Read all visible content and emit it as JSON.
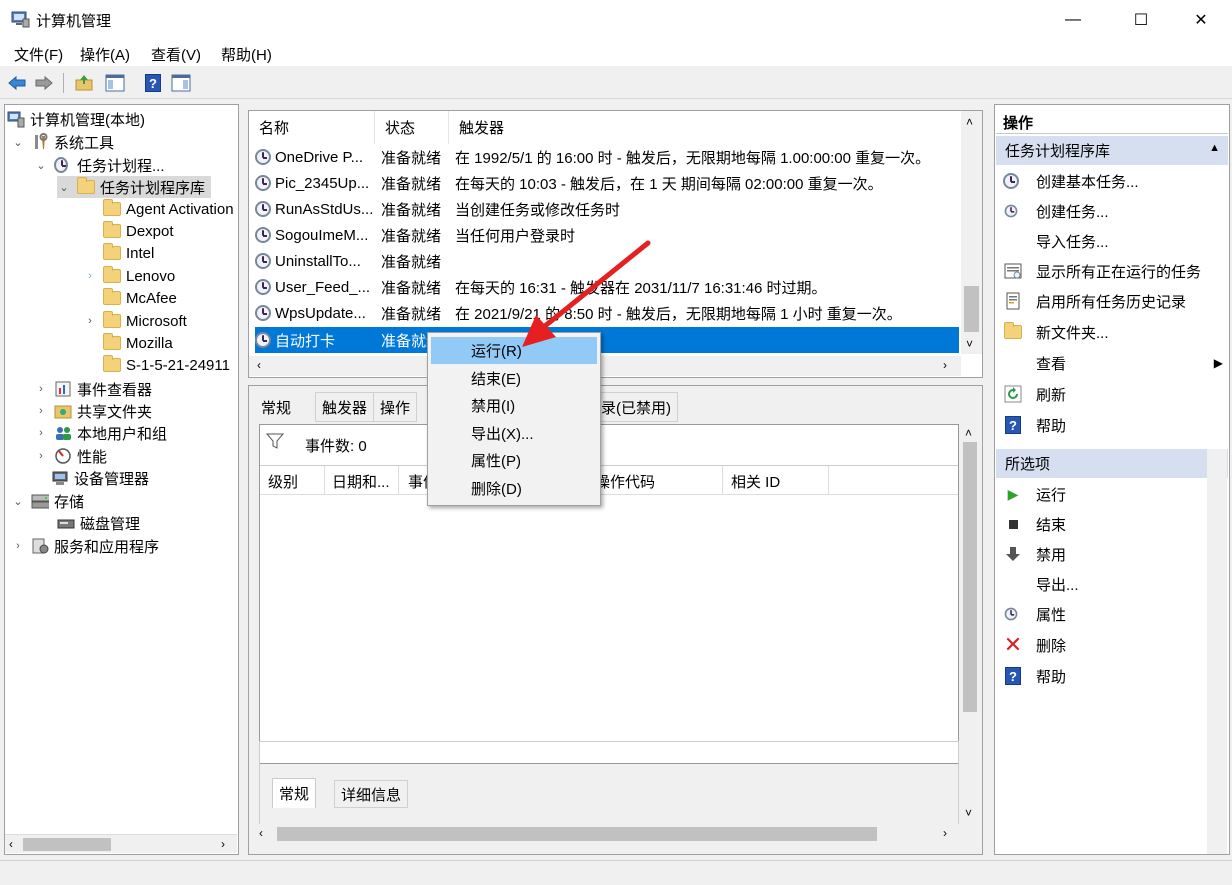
{
  "window": {
    "title": "计算机管理",
    "minimize": "—",
    "maximize": "☐",
    "close": "✕"
  },
  "menu": [
    "文件(F)",
    "操作(A)",
    "查看(V)",
    "帮助(H)"
  ],
  "toolbar": {
    "icons": [
      "back-arrow-icon",
      "forward-arrow-icon",
      "up-folder-icon",
      "show-hide-tree-icon",
      "help-icon",
      "action-pane-icon"
    ]
  },
  "tree": {
    "root": "计算机管理(本地)",
    "system_tools": "系统工具",
    "task_scheduler": "任务计划程...",
    "task_library": "任务计划程序库",
    "folders": [
      "Agent Activation",
      "Dexpot",
      "Intel",
      "Lenovo",
      "McAfee",
      "Microsoft",
      "Mozilla",
      "S-1-5-21-24911"
    ],
    "event_viewer": "事件查看器",
    "shared_folders": "共享文件夹",
    "local_users": "本地用户和组",
    "performance": "性能",
    "device_manager": "设备管理器",
    "storage": "存储",
    "disk_management": "磁盘管理",
    "services_apps": "服务和应用程序"
  },
  "task_list": {
    "columns": [
      "名称",
      "状态",
      "触发器"
    ],
    "rows": [
      {
        "name": "OneDrive P...",
        "status": "准备就绪",
        "trigger": "在 1992/5/1 的 16:00 时 - 触发后，无限期地每隔 1.00:00:00 重复一次。"
      },
      {
        "name": "Pic_2345Up...",
        "status": "准备就绪",
        "trigger": "在每天的 10:03 - 触发后，在 1 天 期间每隔 02:00:00 重复一次。"
      },
      {
        "name": "RunAsStdUs...",
        "status": "准备就绪",
        "trigger": "当创建任务或修改任务时"
      },
      {
        "name": "SogouImeM...",
        "status": "准备就绪",
        "trigger": "当任何用户登录时"
      },
      {
        "name": "UninstallTo...",
        "status": "准备就绪",
        "trigger": ""
      },
      {
        "name": "User_Feed_...",
        "status": "准备就绪",
        "trigger": "在每天的 16:31 - 触发器在 2031/11/7 16:31:46 时过期。"
      },
      {
        "name": "WpsUpdate...",
        "status": "准备就绪",
        "trigger": "在 2021/9/21 的 8:50 时 - 触发后，无限期地每隔 1 小时 重复一次。"
      },
      {
        "name": "自动打卡",
        "status": "准备就绪",
        "trigger": ""
      }
    ]
  },
  "context_menu": [
    "运行(R)",
    "结束(E)",
    "禁用(I)",
    "导出(X)...",
    "属性(P)",
    "删除(D)"
  ],
  "detail": {
    "tabs": [
      "常规",
      "触发器",
      "操作",
      "记录(已禁用)"
    ],
    "event_count": "事件数: 0",
    "columns": [
      "级别",
      "日期和...",
      "事件",
      "操作代码",
      "相关 ID"
    ],
    "bottom_tabs": [
      "常规",
      "详细信息"
    ]
  },
  "actions": {
    "header": "操作",
    "group1": "任务计划程序库",
    "group1_items": [
      "创建基本任务...",
      "创建任务...",
      "导入任务...",
      "显示所有正在运行的任务",
      "启用所有任务历史记录",
      "新文件夹...",
      "查看",
      "刷新",
      "帮助"
    ],
    "group2": "所选项",
    "group2_items": [
      "运行",
      "结束",
      "禁用",
      "导出...",
      "属性",
      "删除",
      "帮助"
    ]
  },
  "colors": {
    "selection": "#0078d7",
    "menu_highlight": "#91c9f7",
    "group_header": "#d6dff0",
    "annotation_arrow": "#e62020"
  }
}
